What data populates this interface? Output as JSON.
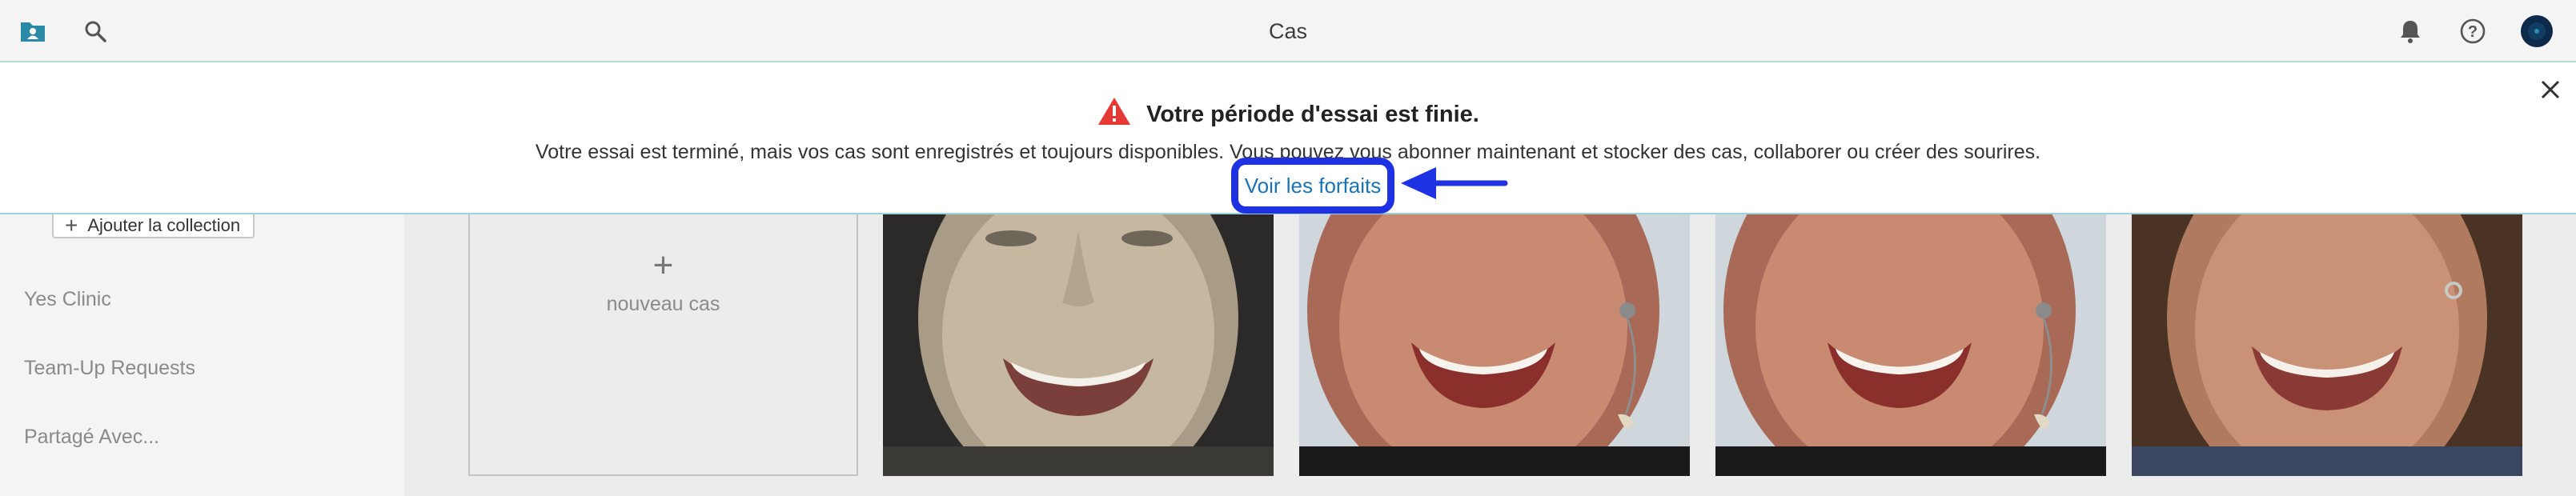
{
  "header": {
    "title": "Cas",
    "icons": [
      "folder-user-icon",
      "search-icon",
      "bell-icon",
      "help-icon",
      "avatar"
    ]
  },
  "banner": {
    "heading": "Votre période d'essai est finie.",
    "message": "Votre essai est terminé, mais vos cas sont enregistrés et toujours disponibles. Vous pouvez vous abonner maintenant et stocker des cas, collaborer ou créer des sourires.",
    "link_label": "Voir les forfaits",
    "warning_color": "#e53935",
    "highlight_color": "#1f32e3"
  },
  "sidebar": {
    "add_collection_label": "Ajouter la collection",
    "items": [
      {
        "label": "Yes Clinic"
      },
      {
        "label": "Team-Up Requests"
      },
      {
        "label": "Partagé Avec..."
      }
    ]
  },
  "gallery": {
    "new_case_label": "nouveau cas",
    "photos": [
      "patient-photo-1",
      "patient-photo-2",
      "patient-photo-3",
      "patient-photo-4"
    ]
  },
  "colors": {
    "accent": "#1e8fa3",
    "link": "#1a73b5"
  }
}
